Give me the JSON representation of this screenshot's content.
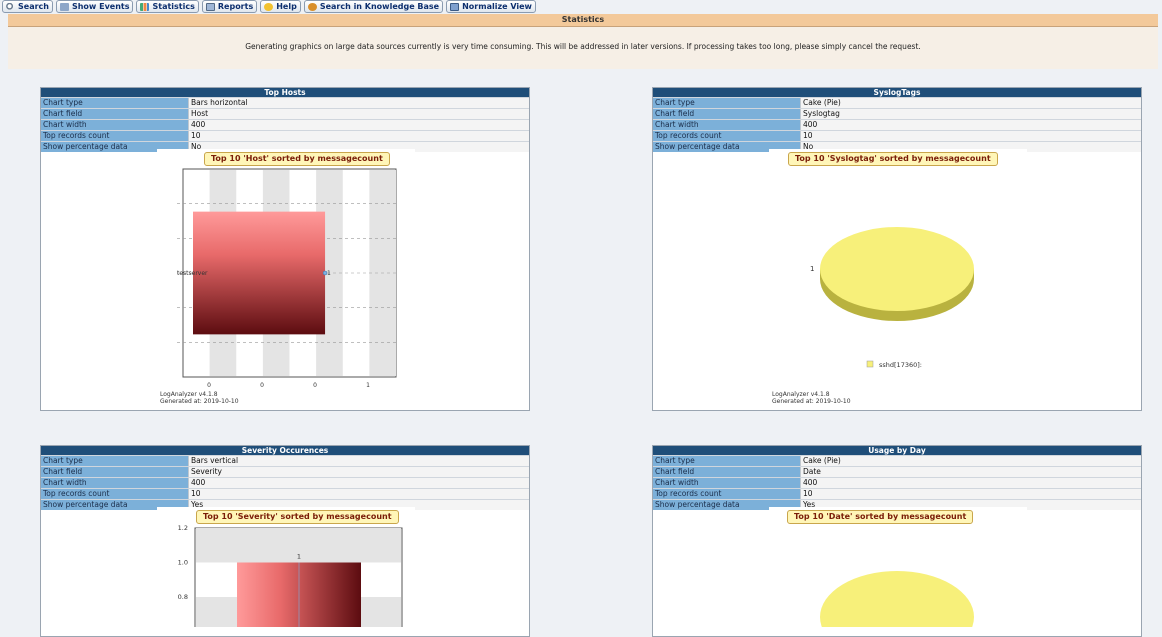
{
  "toolbar": {
    "buttons": [
      {
        "label": "Search",
        "icon": "search-icon"
      },
      {
        "label": "Show Events",
        "icon": "events-icon"
      },
      {
        "label": "Statistics",
        "icon": "statistics-icon"
      },
      {
        "label": "Reports",
        "icon": "reports-icon"
      },
      {
        "label": "Help",
        "icon": "help-icon"
      },
      {
        "label": "Search in Knowledge Base",
        "icon": "knowledge-base-icon"
      },
      {
        "label": "Normalize View",
        "icon": "normalize-icon"
      }
    ]
  },
  "section_title": "Statistics",
  "notice": "Generating graphics on large data sources currently is very time consuming. This will be addressed in later versions. If processing takes too long, please simply cancel the request.",
  "colors": {
    "panel_header": "#1f4e79",
    "label_bg": "#7cb0d9",
    "section_bar": "#f3c99a",
    "pie": "#f7f07a",
    "bar_light": "#ff9a9a",
    "bar_dark": "#5c0c10"
  },
  "panels": [
    {
      "title": "Top Hosts",
      "props": [
        {
          "label": "Chart type",
          "value": "Bars horizontal"
        },
        {
          "label": "Chart field",
          "value": "Host"
        },
        {
          "label": "Chart width",
          "value": "400"
        },
        {
          "label": "Top records count",
          "value": "10"
        },
        {
          "label": "Show percentage data",
          "value": "No"
        }
      ],
      "chart_title": "Top 10 'Host' sorted by messagecount",
      "footer_version": "LogAnalyzer v4.1.8",
      "footer_generated": "Generated at: 2019-10-10"
    },
    {
      "title": "SyslogTags",
      "props": [
        {
          "label": "Chart type",
          "value": "Cake (Pie)"
        },
        {
          "label": "Chart field",
          "value": "Syslogtag"
        },
        {
          "label": "Chart width",
          "value": "400"
        },
        {
          "label": "Top records count",
          "value": "10"
        },
        {
          "label": "Show percentage data",
          "value": "No"
        }
      ],
      "chart_title": "Top 10 'Syslogtag' sorted by messagecount",
      "footer_version": "LogAnalyzer v4.1.8",
      "footer_generated": "Generated at: 2019-10-10"
    },
    {
      "title": "Severity Occurences",
      "props": [
        {
          "label": "Chart type",
          "value": "Bars vertical"
        },
        {
          "label": "Chart field",
          "value": "Severity"
        },
        {
          "label": "Chart width",
          "value": "400"
        },
        {
          "label": "Top records count",
          "value": "10"
        },
        {
          "label": "Show percentage data",
          "value": "Yes"
        }
      ],
      "chart_title": "Top 10 'Severity' sorted by messagecount"
    },
    {
      "title": "Usage by Day",
      "props": [
        {
          "label": "Chart type",
          "value": "Cake (Pie)"
        },
        {
          "label": "Chart field",
          "value": "Date"
        },
        {
          "label": "Chart width",
          "value": "400"
        },
        {
          "label": "Top records count",
          "value": "10"
        },
        {
          "label": "Show percentage data",
          "value": "Yes"
        }
      ],
      "chart_title": "Top 10 'Date' sorted by messagecount"
    }
  ],
  "chart_data": [
    {
      "type": "bar",
      "orientation": "horizontal",
      "title": "Top 10 'Host' sorted by messagecount",
      "categories": [
        "testserver"
      ],
      "values": [
        1
      ],
      "data_labels": [
        "1"
      ],
      "x_tick_labels": [
        "0",
        "0",
        "0",
        "1"
      ],
      "grid": true
    },
    {
      "type": "pie",
      "title": "Top 10 'Syslogtag' sorted by messagecount",
      "categories": [
        "sshd[17360]:"
      ],
      "values": [
        1
      ],
      "data_labels": [
        "1"
      ],
      "legend": [
        "sshd[17360]:"
      ],
      "legend_position": "bottom"
    },
    {
      "type": "bar",
      "orientation": "vertical",
      "title": "Top 10 'Severity' sorted by messagecount",
      "values": [
        1
      ],
      "data_labels": [
        "1"
      ],
      "y_tick_labels": [
        "1.2",
        "1.0",
        "0.8"
      ],
      "ylim": [
        0,
        1.2
      ],
      "grid": true
    },
    {
      "type": "pie",
      "title": "Top 10 'Date' sorted by messagecount",
      "values": [
        1
      ]
    }
  ]
}
